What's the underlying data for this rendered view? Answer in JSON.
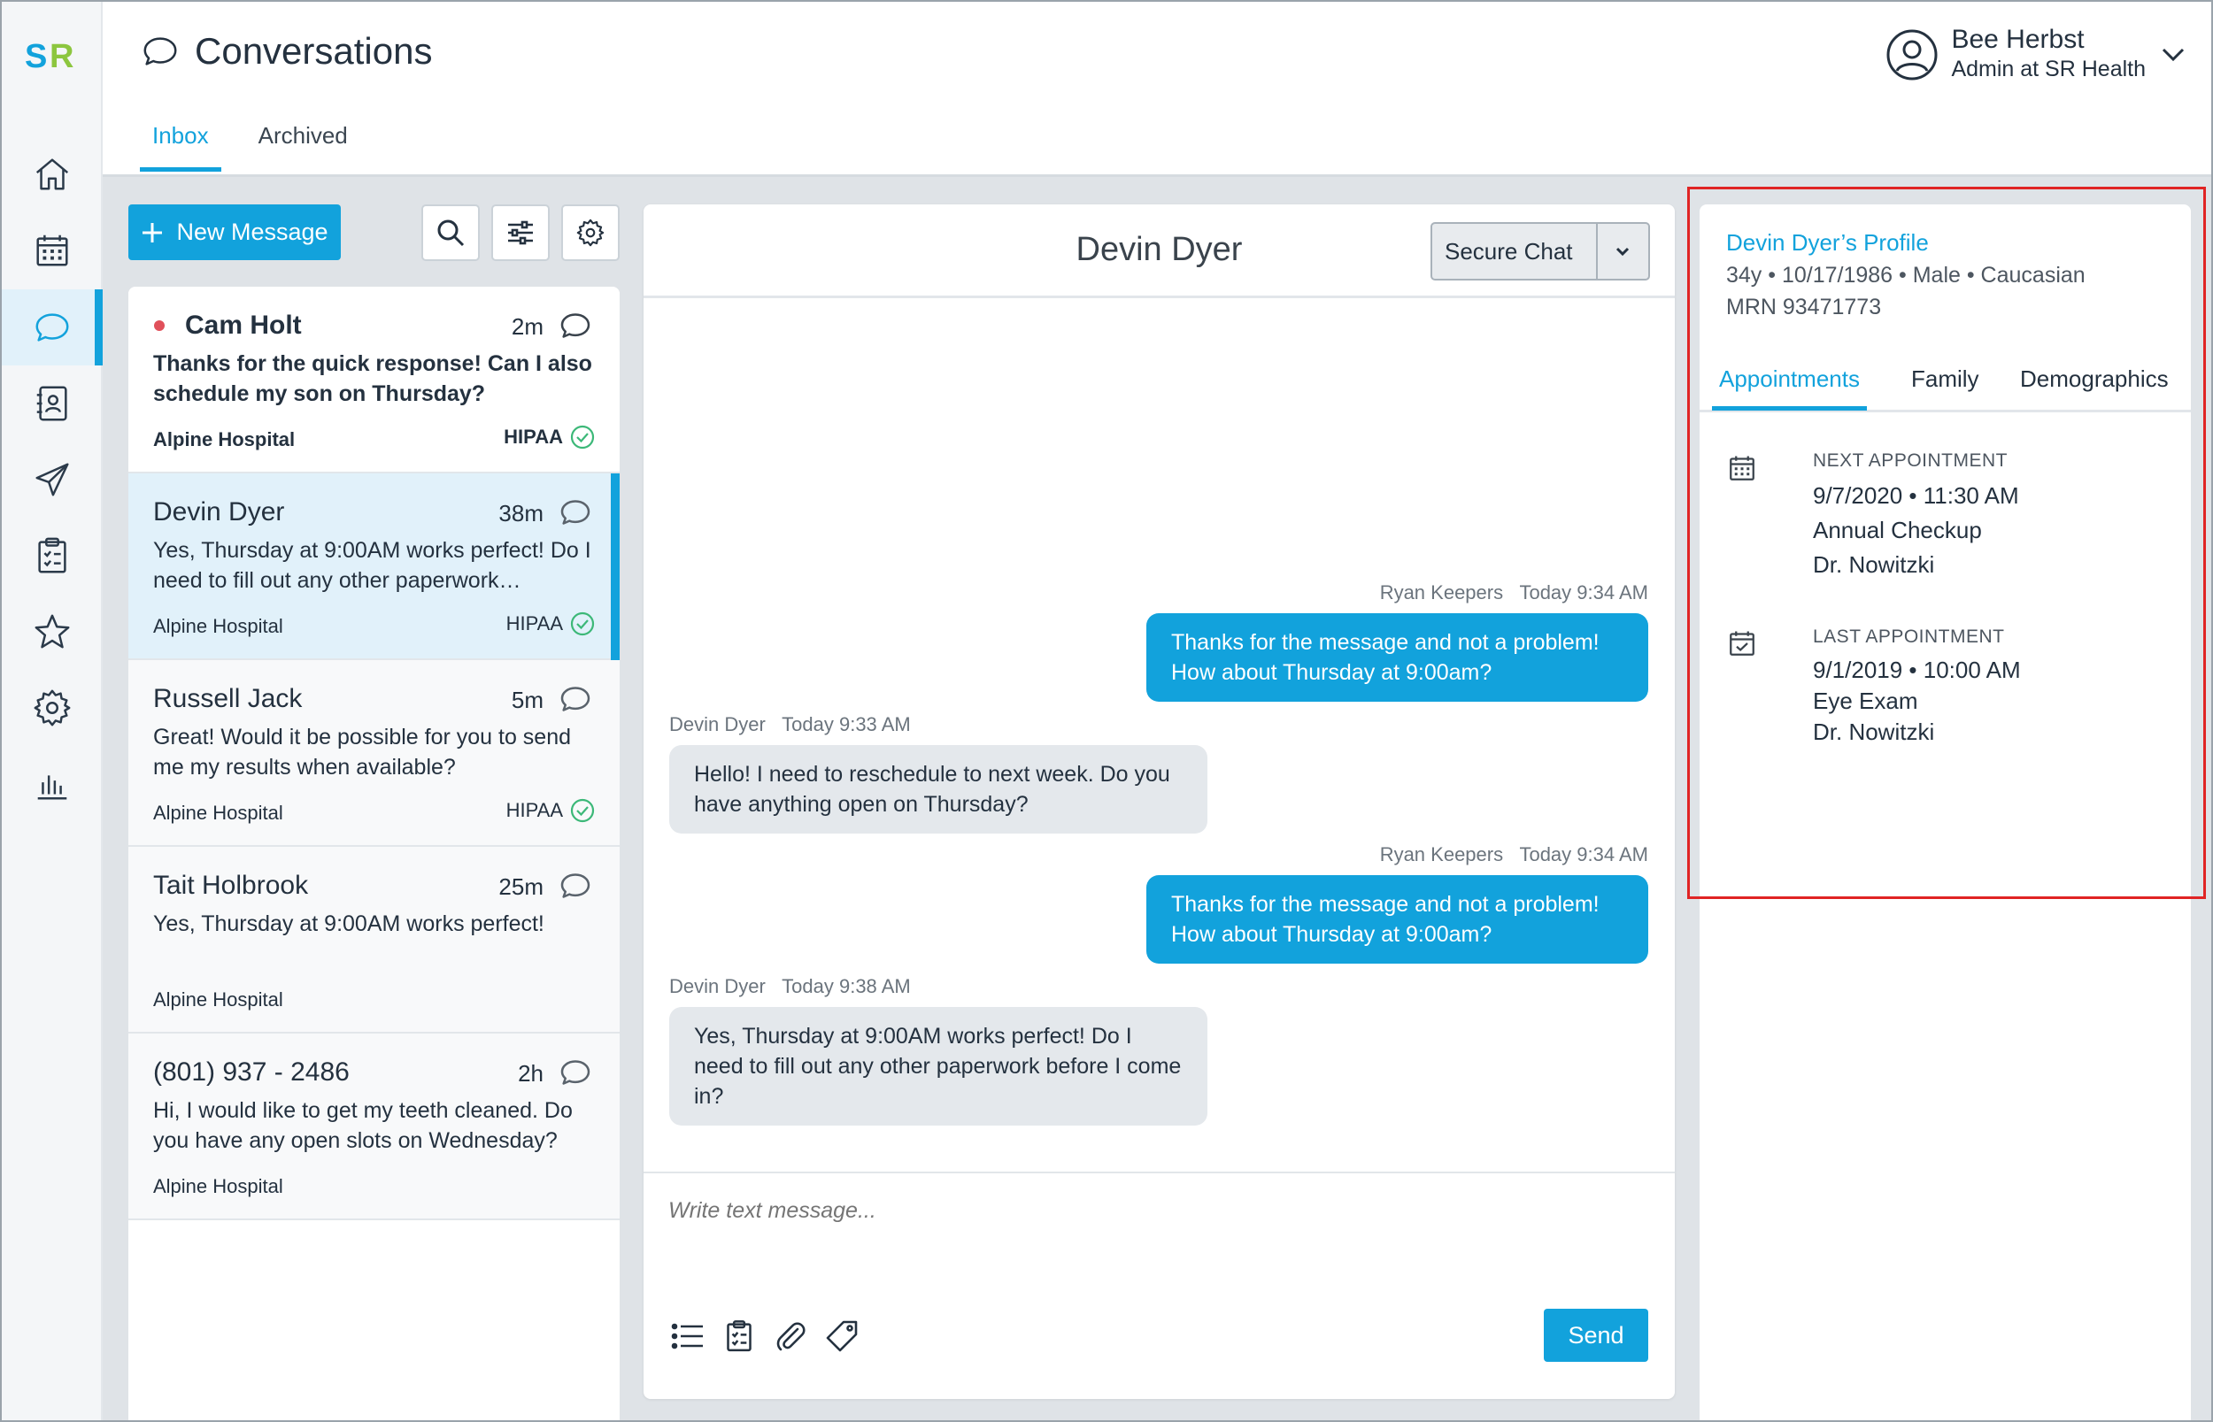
{
  "brand": {
    "logo_text": "SR",
    "accent": "#12a2dc"
  },
  "header": {
    "title": "Conversations",
    "tabs": [
      {
        "label": "Inbox"
      },
      {
        "label": "Archived"
      }
    ],
    "user": {
      "name": "Bee Herbst",
      "role": "Admin at SR Health"
    }
  },
  "sidebar": {
    "items": [
      {
        "icon": "home-icon"
      },
      {
        "icon": "calendar-icon"
      },
      {
        "icon": "chat-icon"
      },
      {
        "icon": "contacts-icon"
      },
      {
        "icon": "send-icon"
      },
      {
        "icon": "clipboard-icon"
      },
      {
        "icon": "star-icon"
      },
      {
        "icon": "gear-icon"
      },
      {
        "icon": "bar-chart-icon"
      }
    ]
  },
  "toolbar": {
    "new_message_label": "New Message"
  },
  "conversations": [
    {
      "name": "Cam Holt",
      "time": "2m",
      "preview": "Thanks for the quick response! Can I also schedule my son on Thursday?",
      "org": "Alpine Hospital",
      "hipaa": "HIPAA",
      "unread": true
    },
    {
      "name": "Devin Dyer",
      "time": "38m",
      "preview": "Yes, Thursday at 9:00AM works perfect! Do I need to fill out any other paperwork…",
      "org": "Alpine Hospital",
      "hipaa": "HIPAA",
      "selected": true
    },
    {
      "name": "Russell Jack",
      "time": "5m",
      "preview": "Great! Would it be possible for you to send me my results when available?",
      "org": "Alpine Hospital",
      "hipaa": "HIPAA"
    },
    {
      "name": "Tait Holbrook",
      "time": "25m",
      "preview": "Yes, Thursday at 9:00AM works perfect!",
      "org": "Alpine Hospital",
      "hipaa": ""
    },
    {
      "name": "(801) 937 - 2486",
      "time": "2h",
      "preview": "Hi, I would like to get my teeth cleaned. Do you have any open slots on Wednesday?",
      "org": "Alpine Hospital",
      "hipaa": ""
    }
  ],
  "chat": {
    "title": "Devin Dyer",
    "channel": "Secure Chat",
    "messages": [
      {
        "sender": "Ryan Keepers",
        "time": "Today 9:34 AM",
        "text": "Thanks for the message and not a problem! How about Thursday at 9:00am?",
        "direction": "out"
      },
      {
        "sender": "Devin Dyer",
        "time": "Today 9:33 AM",
        "text": "Hello! I need to reschedule to next week. Do you have anything open on Thursday?",
        "direction": "in"
      },
      {
        "sender": "Ryan Keepers",
        "time": "Today 9:34 AM",
        "text": "Thanks for the message and not a problem! How about Thursday at 9:00am?",
        "direction": "out"
      },
      {
        "sender": "Devin Dyer",
        "time": "Today 9:38 AM",
        "text": "Yes, Thursday at 9:00AM works perfect! Do I need to fill out any other paperwork before I come in?",
        "direction": "in"
      }
    ],
    "composer_placeholder": "Write text message...",
    "send_label": "Send"
  },
  "profile": {
    "title": "Devin Dyer’s Profile",
    "details": "34y • 10/17/1986 • Male • Caucasian",
    "mrn": "MRN 93471773",
    "tabs": [
      {
        "label": "Appointments"
      },
      {
        "label": "Family"
      },
      {
        "label": "Demographics"
      }
    ],
    "next": {
      "label": "NEXT APPOINTMENT",
      "datetime": "9/7/2020 • 11:30 AM",
      "type": "Annual Checkup",
      "provider": "Dr. Nowitzki"
    },
    "last": {
      "label": "LAST APPOINTMENT",
      "datetime": "9/1/2019 • 10:00 AM",
      "type": "Eye Exam",
      "provider": "Dr. Nowitzki"
    }
  }
}
